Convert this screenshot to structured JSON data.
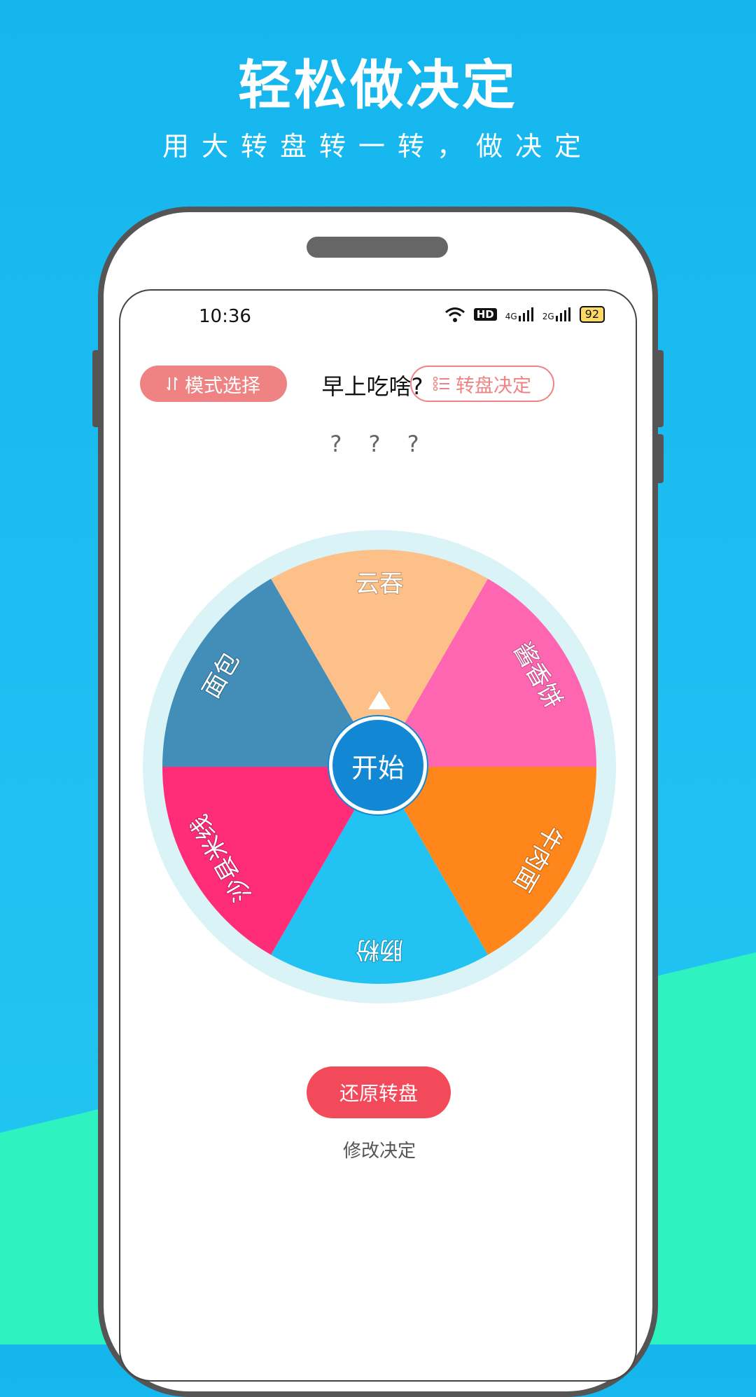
{
  "promo": {
    "headline": "轻松做决定",
    "subline": "用大转盘转一转，做决定"
  },
  "status_bar": {
    "time": "10:36",
    "hd": "HD",
    "net1": "4G",
    "net2": "2G",
    "battery": "92"
  },
  "header": {
    "mode_button": "模式选择",
    "title": "早上吃啥?",
    "decide_button": "转盘决定"
  },
  "result_text": "? ? ?",
  "wheel": {
    "segments": [
      {
        "label": "云吞",
        "color": "#fdc088"
      },
      {
        "label": "酱香饼",
        "color": "#ff66b2"
      },
      {
        "label": "牛肉面",
        "color": "#ff861b"
      },
      {
        "label": "肠粉",
        "color": "#22c3f2"
      },
      {
        "label": "沙县米线",
        "color": "#ff2c78"
      },
      {
        "label": "面包",
        "color": "#428eb9"
      }
    ],
    "rim_color": "#daf3f7",
    "start_label": "开始"
  },
  "actions": {
    "reset_button": "还原转盘",
    "modify_link": "修改决定"
  }
}
